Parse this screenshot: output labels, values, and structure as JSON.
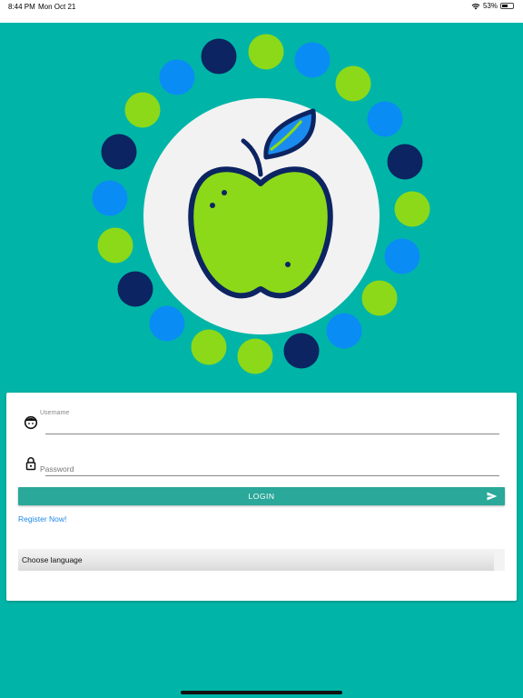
{
  "status_bar": {
    "time": "8:44 PM",
    "date": "Mon Oct 21",
    "battery_percent": "53%",
    "battery_level": 0.53,
    "wifi_icon": "wifi-icon",
    "battery_icon": "battery-icon"
  },
  "logo": {
    "icon": "apple-logo",
    "colors": {
      "lime": "#8cd919",
      "blue": "#0a8cf5",
      "navy": "#0c2461",
      "plate": "#f2f2f2"
    }
  },
  "login": {
    "username_label": "Username",
    "password_placeholder": "Password",
    "login_button": "LOGIN",
    "register_link": "Register Now!",
    "language_select": "Choose language"
  },
  "colors": {
    "background": "#00b5a7",
    "button": "#2aa899",
    "link": "#1e88e5"
  }
}
